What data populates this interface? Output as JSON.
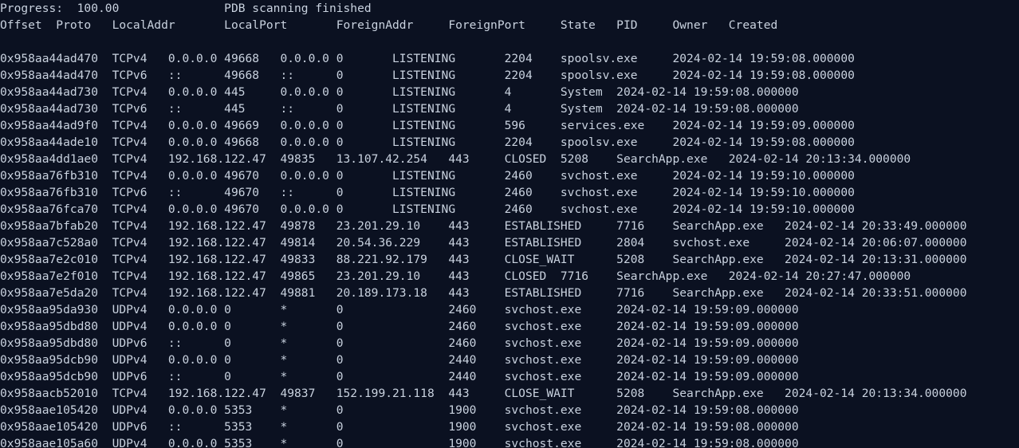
{
  "terminal": {
    "lines": [
      "Progress:  100.00               PDB scanning finished",
      "Offset  Proto   LocalAddr       LocalPort       ForeignAddr     ForeignPort     State   PID     Owner   Created",
      "",
      "0x958aa44ad470  TCPv4   0.0.0.0 49668   0.0.0.0 0       LISTENING       2204    spoolsv.exe     2024-02-14 19:59:08.000000",
      "0x958aa44ad470  TCPv6   ::      49668   ::      0       LISTENING       2204    spoolsv.exe     2024-02-14 19:59:08.000000",
      "0x958aa44ad730  TCPv4   0.0.0.0 445     0.0.0.0 0       LISTENING       4       System  2024-02-14 19:59:08.000000",
      "0x958aa44ad730  TCPv6   ::      445     ::      0       LISTENING       4       System  2024-02-14 19:59:08.000000",
      "0x958aa44ad9f0  TCPv4   0.0.0.0 49669   0.0.0.0 0       LISTENING       596     services.exe    2024-02-14 19:59:09.000000",
      "0x958aa44ade10  TCPv4   0.0.0.0 49668   0.0.0.0 0       LISTENING       2204    spoolsv.exe     2024-02-14 19:59:08.000000",
      "0x958aa4dd1ae0  TCPv4   192.168.122.47  49835   13.107.42.254   443     CLOSED  5208    SearchApp.exe   2024-02-14 20:13:34.000000",
      "0x958aa76fb310  TCPv4   0.0.0.0 49670   0.0.0.0 0       LISTENING       2460    svchost.exe     2024-02-14 19:59:10.000000",
      "0x958aa76fb310  TCPv6   ::      49670   ::      0       LISTENING       2460    svchost.exe     2024-02-14 19:59:10.000000",
      "0x958aa76fca70  TCPv4   0.0.0.0 49670   0.0.0.0 0       LISTENING       2460    svchost.exe     2024-02-14 19:59:10.000000",
      "0x958aa7bfab20  TCPv4   192.168.122.47  49878   23.201.29.10    443     ESTABLISHED     7716    SearchApp.exe   2024-02-14 20:33:49.000000",
      "0x958aa7c528a0  TCPv4   192.168.122.47  49814   20.54.36.229    443     ESTABLISHED     2804    svchost.exe     2024-02-14 20:06:07.000000",
      "0x958aa7e2c010  TCPv4   192.168.122.47  49833   88.221.92.179   443     CLOSE_WAIT      5208    SearchApp.exe   2024-02-14 20:13:31.000000",
      "0x958aa7e2f010  TCPv4   192.168.122.47  49865   23.201.29.10    443     CLOSED  7716    SearchApp.exe   2024-02-14 20:27:47.000000",
      "0x958aa7e5da20  TCPv4   192.168.122.47  49881   20.189.173.18   443     ESTABLISHED     7716    SearchApp.exe   2024-02-14 20:33:51.000000",
      "0x958aa95da930  UDPv4   0.0.0.0 0       *       0               2460    svchost.exe     2024-02-14 19:59:09.000000",
      "0x958aa95dbd80  UDPv4   0.0.0.0 0       *       0               2460    svchost.exe     2024-02-14 19:59:09.000000",
      "0x958aa95dbd80  UDPv6   ::      0       *       0               2460    svchost.exe     2024-02-14 19:59:09.000000",
      "0x958aa95dcb90  UDPv4   0.0.0.0 0       *       0               2440    svchost.exe     2024-02-14 19:59:09.000000",
      "0x958aa95dcb90  UDPv6   ::      0       *       0               2440    svchost.exe     2024-02-14 19:59:09.000000",
      "0x958aacb52010  TCPv4   192.168.122.47  49837   152.199.21.118  443     CLOSE_WAIT      5208    SearchApp.exe   2024-02-14 20:13:34.000000",
      "0x958aae105420  UDPv4   0.0.0.0 5353    *       0               1900    svchost.exe     2024-02-14 19:59:08.000000",
      "0x958aae105420  UDPv6   ::      5353    *       0               1900    svchost.exe     2024-02-14 19:59:08.000000",
      "0x958aae105a60  UDPv4   0.0.0.0 5353    *       0               1900    svchost.exe     2024-02-14 19:59:08.000000"
    ]
  }
}
